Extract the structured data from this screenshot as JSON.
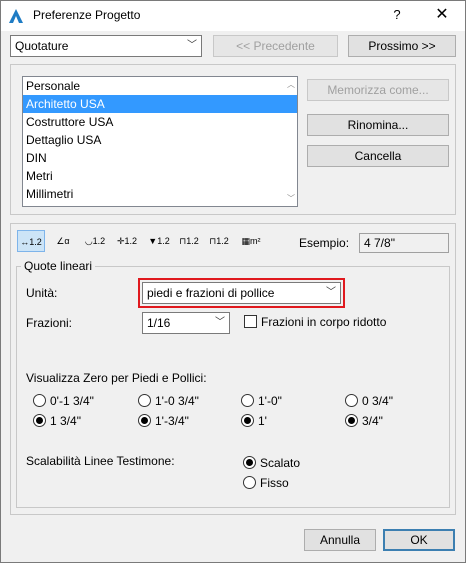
{
  "window": {
    "title": "Preferenze Progetto",
    "help": "?",
    "close": "✕"
  },
  "header": {
    "category": "Quotature",
    "prev_label": "<< Precedente",
    "next_label": "Prossimo >>"
  },
  "presets": {
    "items": [
      {
        "label": "Personale"
      },
      {
        "label": "Architetto USA",
        "selected": true
      },
      {
        "label": "Costruttore USA"
      },
      {
        "label": "Dettaglio USA"
      },
      {
        "label": "DIN"
      },
      {
        "label": "Metri"
      },
      {
        "label": "Millimetri"
      }
    ],
    "store_label": "Memorizza come...",
    "rename_label": "Rinomina...",
    "delete_label": "Cancella"
  },
  "tools": [
    {
      "icon": "linear-dimension-icon",
      "glyph": "↔1.2",
      "selected": true
    },
    {
      "icon": "angle-dimension-icon",
      "glyph": "∠α"
    },
    {
      "icon": "radial-dimension-icon",
      "glyph": "◡1.2"
    },
    {
      "icon": "level-dimension-icon",
      "glyph": "✛1.2"
    },
    {
      "icon": "elevation-dimension-icon",
      "glyph": "▼1.2"
    },
    {
      "icon": "door-window-dimension-icon",
      "glyph": "⊓1.2"
    },
    {
      "icon": "sill-height-dimension-icon",
      "glyph": "⊓1.2"
    },
    {
      "icon": "area-calculation-icon",
      "glyph": "▦m²"
    }
  ],
  "example": {
    "label": "Esempio:",
    "value": "4 7/8\""
  },
  "linear": {
    "group_title": "Quote lineari",
    "unit_label": "Unità:",
    "unit_value": "piedi e frazioni di pollice",
    "fractions_label": "Frazioni:",
    "fractions_value": "1/16",
    "reduced_label": "Frazioni in corpo ridotto",
    "zero_label": "Visualizza Zero per Piedi e Pollici:",
    "zero_options": [
      {
        "label": "0'-1 3/4\"",
        "checked": false
      },
      {
        "label": "1'-0 3/4\"",
        "checked": false
      },
      {
        "label": "1'-0\"",
        "checked": false
      },
      {
        "label": "0 3/4\"",
        "checked": false
      },
      {
        "label": "1 3/4\"",
        "checked": true
      },
      {
        "label": "1'-3/4\"",
        "checked": true
      },
      {
        "label": "1'",
        "checked": true
      },
      {
        "label": "3/4\"",
        "checked": true
      }
    ],
    "scaling_label": "Scalabilità Linee Testimone:",
    "scaled_label": "Scalato",
    "fixed_label": "Fisso",
    "scaled_checked": true
  },
  "footer": {
    "cancel_label": "Annulla",
    "ok_label": "OK"
  },
  "colors": {
    "selection": "#3399ff",
    "highlight_border": "#e0191e",
    "default_button_border": "#3c7fb1"
  }
}
